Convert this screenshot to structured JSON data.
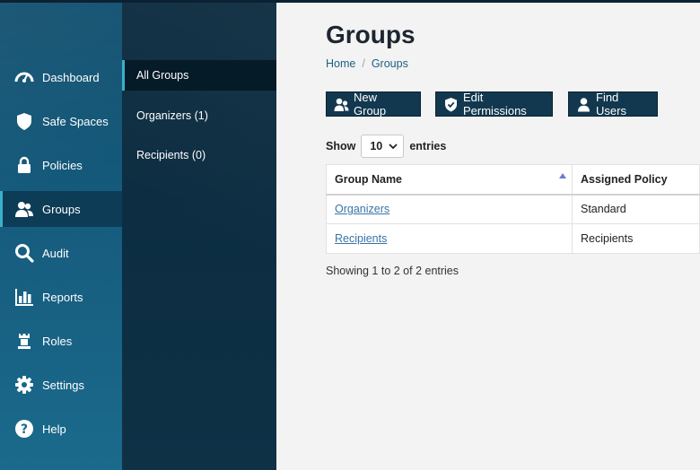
{
  "nav": {
    "items": [
      {
        "label": "Dashboard",
        "icon": "gauge-icon"
      },
      {
        "label": "Safe Spaces",
        "icon": "shield-icon"
      },
      {
        "label": "Policies",
        "icon": "lock-icon"
      },
      {
        "label": "Groups",
        "icon": "users-icon",
        "active": true
      },
      {
        "label": "Audit",
        "icon": "search-icon"
      },
      {
        "label": "Reports",
        "icon": "bar-chart-icon"
      },
      {
        "label": "Roles",
        "icon": "chess-rook-icon"
      },
      {
        "label": "Settings",
        "icon": "gear-icon"
      },
      {
        "label": "Help",
        "icon": "help-icon"
      }
    ]
  },
  "subnav": {
    "items": [
      {
        "label": "All Groups",
        "active": true
      },
      {
        "label": "Organizers (1)"
      },
      {
        "label": "Recipients (0)"
      }
    ]
  },
  "page": {
    "title": "Groups",
    "breadcrumb": {
      "home": "Home",
      "separator": "/",
      "current": "Groups"
    }
  },
  "toolbar": {
    "new_group": "New Group",
    "edit_permissions": "Edit Permissions",
    "find_users": "Find Users"
  },
  "table": {
    "show_label": "Show",
    "page_size": "10",
    "entries_label": "entries",
    "columns": [
      "Group Name",
      "Assigned Policy"
    ],
    "rows": [
      {
        "name": "Organizers",
        "policy": "Standard"
      },
      {
        "name": "Recipients",
        "policy": "Recipients"
      }
    ],
    "info": "Showing 1 to 2 of 2 entries"
  },
  "colors": {
    "nav_bg": "#175e80",
    "subnav_bg": "#0b2a3e",
    "button_bg": "#12384f",
    "link": "#3a73a8",
    "active_accent": "#39b0c8"
  }
}
